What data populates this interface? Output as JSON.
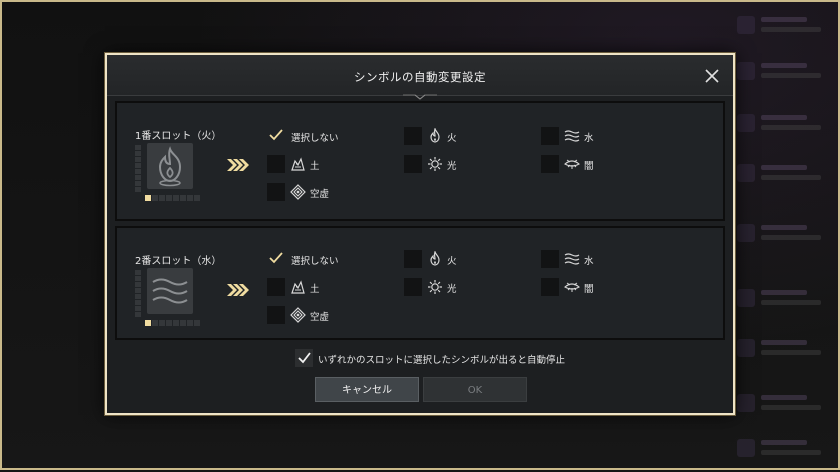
{
  "dialog": {
    "title": "シンボルの自動変更設定",
    "close_icon": "close-icon"
  },
  "slots": [
    {
      "title": "1番スロット（火）",
      "element_icon": "fire-icon",
      "progress_filled": 1,
      "progress_total": 8,
      "options": [
        {
          "label": "選択しない",
          "icon": null,
          "checked": true
        },
        {
          "label": "火",
          "icon": "fire-icon",
          "checked": false
        },
        {
          "label": "水",
          "icon": "water-icon",
          "checked": false
        },
        {
          "label": "土",
          "icon": "earth-icon",
          "checked": false
        },
        {
          "label": "光",
          "icon": "light-icon",
          "checked": false
        },
        {
          "label": "闇",
          "icon": "dark-icon",
          "checked": false
        },
        {
          "label": "空虚",
          "icon": "void-icon",
          "checked": false
        }
      ]
    },
    {
      "title": "2番スロット（水）",
      "element_icon": "water-icon",
      "progress_filled": 1,
      "progress_total": 8,
      "options": [
        {
          "label": "選択しない",
          "icon": null,
          "checked": true
        },
        {
          "label": "火",
          "icon": "fire-icon",
          "checked": false
        },
        {
          "label": "水",
          "icon": "water-icon",
          "checked": false
        },
        {
          "label": "土",
          "icon": "earth-icon",
          "checked": false
        },
        {
          "label": "光",
          "icon": "light-icon",
          "checked": false
        },
        {
          "label": "闇",
          "icon": "dark-icon",
          "checked": false
        },
        {
          "label": "空虚",
          "icon": "void-icon",
          "checked": false
        }
      ]
    }
  ],
  "footer": {
    "auto_stop_label": "いずれかのスロットに選択したシンボルが出ると自動停止",
    "auto_stop_checked": true,
    "cancel_label": "キャンセル",
    "ok_label": "OK",
    "ok_enabled": false
  },
  "colors": {
    "accent_gold": "#f0dca0",
    "frame": "#efe4c6"
  }
}
